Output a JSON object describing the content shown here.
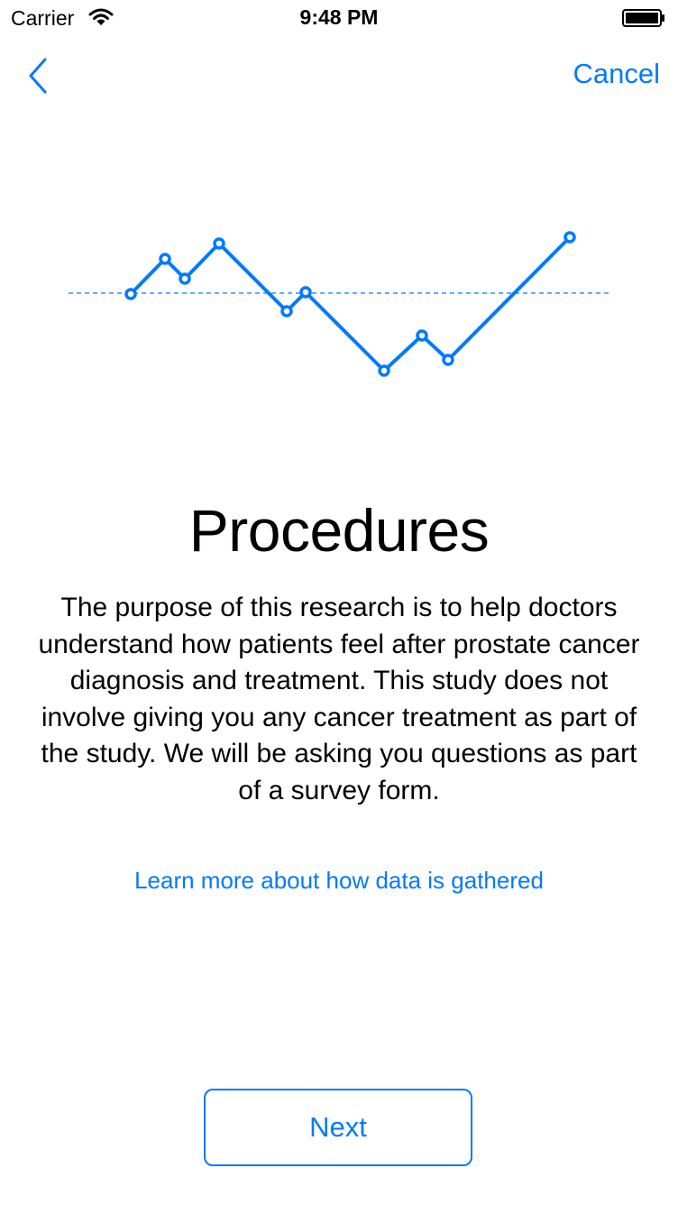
{
  "status_bar": {
    "carrier": "Carrier",
    "time": "9:48 PM",
    "wifi_icon": "wifi-icon",
    "battery_icon": "battery-full-icon"
  },
  "nav": {
    "back_icon": "chevron-left-icon",
    "cancel_label": "Cancel"
  },
  "illustration": {
    "icon": "line-graph-illustration",
    "color": "#007aff"
  },
  "content": {
    "title": "Procedures",
    "body": "The purpose of this research is to help doctors understand how patients feel after prostate cancer diagnosis and treatment. This study does not involve giving you any cancer treatment as part of the study.  We will be asking you questions as part of a survey form.",
    "learn_more_label": "Learn more about how data is gathered"
  },
  "footer": {
    "next_label": "Next"
  },
  "colors": {
    "accent": "#007aff",
    "text": "#000000",
    "background": "#ffffff"
  }
}
